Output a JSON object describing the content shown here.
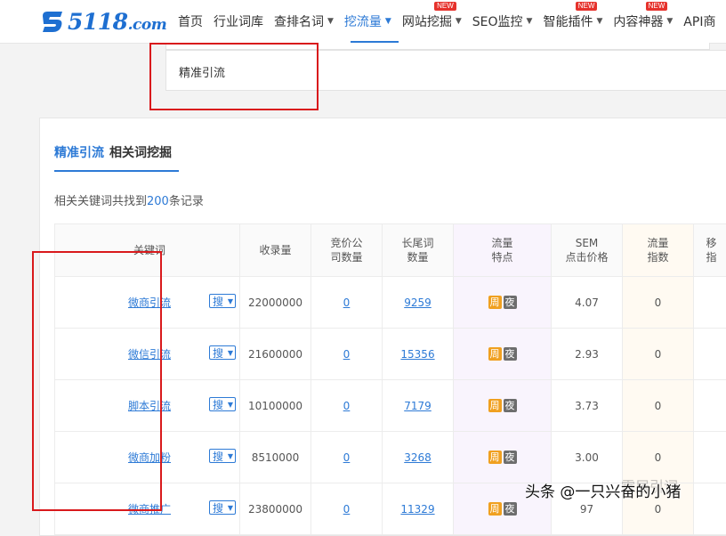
{
  "logo": {
    "text": "5118",
    "suffix": ".com"
  },
  "nav": {
    "items": [
      {
        "label": "首页",
        "caret": false,
        "new": false,
        "active": false
      },
      {
        "label": "行业词库",
        "caret": false,
        "new": false,
        "active": false
      },
      {
        "label": "查排名词",
        "caret": true,
        "new": false,
        "active": false
      },
      {
        "label": "挖流量",
        "caret": true,
        "new": false,
        "active": true
      },
      {
        "label": "网站挖掘",
        "caret": true,
        "new": true,
        "active": false
      },
      {
        "label": "SEO监控",
        "caret": true,
        "new": false,
        "active": false
      },
      {
        "label": "智能插件",
        "caret": true,
        "new": true,
        "active": false
      },
      {
        "label": "内容神器",
        "caret": true,
        "new": true,
        "active": false
      },
      {
        "label": "API商",
        "caret": false,
        "new": false,
        "active": false
      }
    ],
    "new_badge": "NEW"
  },
  "search": {
    "value": "精准引流"
  },
  "tabs": [
    {
      "label": "精准引流",
      "active": true
    },
    {
      "label": "相关词挖掘",
      "active": false
    }
  ],
  "result": {
    "prefix": "相关关键词共找到",
    "count": "200",
    "suffix": "条记录"
  },
  "table": {
    "headers": {
      "keyword": "关键词",
      "indexed": "收录量",
      "bid_a": "竞价公",
      "bid_b": "司数量",
      "long_a": "长尾词",
      "long_b": "数量",
      "feat_a": "流量",
      "feat_b": "特点",
      "sem_a": "SEM",
      "sem_b": "点击价格",
      "idx_a": "流量",
      "idx_b": "指数",
      "more_a": "移",
      "more_b": "指"
    },
    "search_btn": "搜",
    "week": "周",
    "night": "夜",
    "rows": [
      {
        "keyword": "微商引流",
        "indexed": "22000000",
        "bid": "0",
        "longtail": "9259",
        "sem": "4.07",
        "index": "0"
      },
      {
        "keyword": "微信引流",
        "indexed": "21600000",
        "bid": "0",
        "longtail": "15356",
        "sem": "2.93",
        "index": "0"
      },
      {
        "keyword": "脚本引流",
        "indexed": "10100000",
        "bid": "0",
        "longtail": "7179",
        "sem": "3.73",
        "index": "0"
      },
      {
        "keyword": "微商加粉",
        "indexed": "8510000",
        "bid": "0",
        "longtail": "3268",
        "sem": "3.00",
        "index": "0"
      },
      {
        "keyword": "微商推广",
        "indexed": "23800000",
        "bid": "0",
        "longtail": "11329",
        "sem": "97",
        "index": "0"
      }
    ]
  },
  "watermark": {
    "text": "头条 @一只兴奋的小猪",
    "bg_text": "霖居引词"
  },
  "colors": {
    "accent": "#2d7ad6",
    "annotation": "#d9191c",
    "week_badge": "#f0a020",
    "night_badge": "#6d6d6d"
  }
}
